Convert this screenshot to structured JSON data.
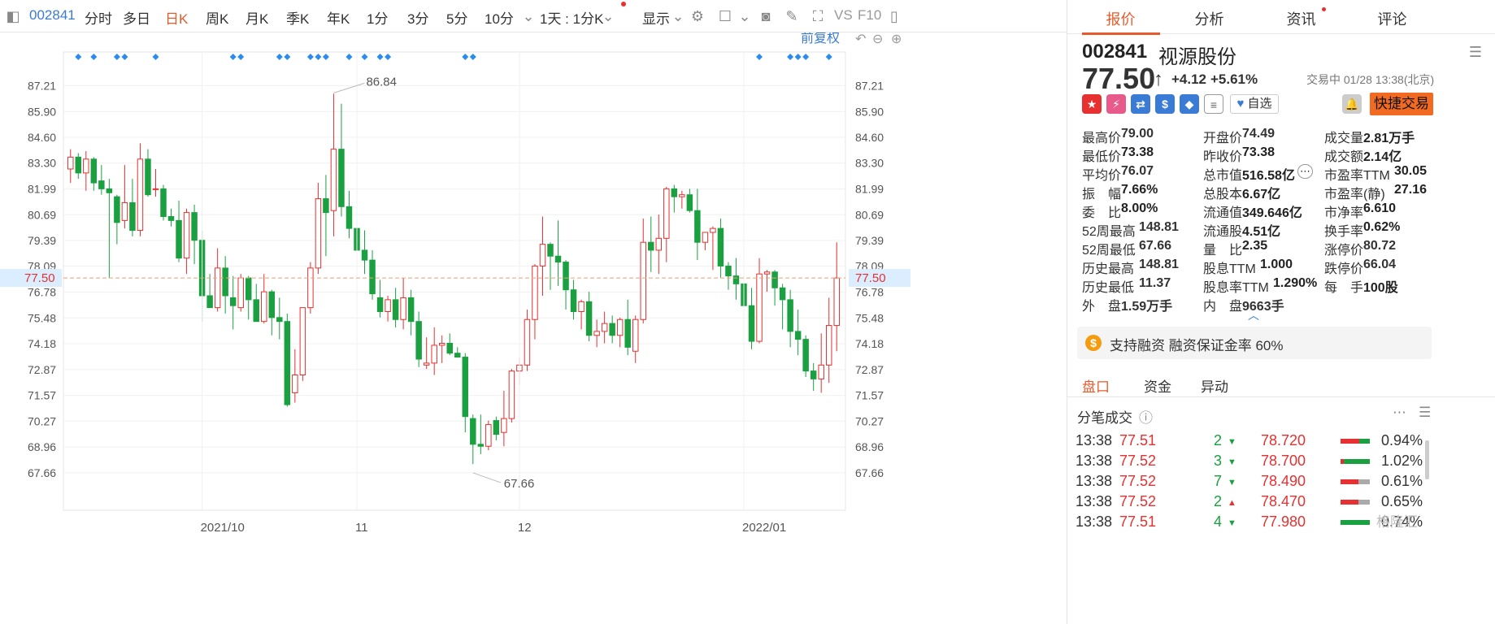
{
  "toolbar": {
    "code": "002841",
    "periods": [
      "分时",
      "多日",
      "日K",
      "周K",
      "月K",
      "季K",
      "年K",
      "1分",
      "3分",
      "5分",
      "10分"
    ],
    "active_period": "日K",
    "range_label": "1天 : 1分K",
    "display_label": "显示",
    "vs_label": "VS",
    "f10_label": "F10"
  },
  "chart": {
    "adjust_label": "前复权",
    "price_ticks": [
      "87.21",
      "85.90",
      "84.60",
      "83.30",
      "81.99",
      "80.69",
      "79.39",
      "78.09",
      "76.78",
      "75.48",
      "74.18",
      "72.87",
      "71.57",
      "70.27",
      "68.96",
      "67.66"
    ],
    "current_price_label": "77.50",
    "date_labels": [
      "2021/10",
      "11",
      "12",
      "2022/01"
    ],
    "max_label": "86.84",
    "min_label": "67.66",
    "accent_up": "#e73030",
    "accent_down": "#1aa040"
  },
  "chart_data": {
    "type": "candlestick",
    "ylim": [
      67.0,
      87.8
    ],
    "last_price": 77.5,
    "high_marker": 86.84,
    "low_marker": 67.66,
    "x_labels": [
      "2021/10",
      "11",
      "12",
      "2022/01"
    ],
    "candles": [
      [
        83.0,
        84.0,
        82.3,
        83.6
      ],
      [
        83.6,
        83.8,
        82.5,
        82.8
      ],
      [
        82.8,
        83.9,
        81.9,
        83.5
      ],
      [
        83.5,
        83.6,
        81.9,
        82.3
      ],
      [
        82.4,
        83.2,
        81.7,
        82.0
      ],
      [
        82.0,
        82.5,
        77.5,
        81.8
      ],
      [
        81.6,
        81.7,
        79.2,
        80.3
      ],
      [
        80.4,
        83.2,
        80.0,
        81.3
      ],
      [
        81.3,
        82.5,
        79.6,
        79.9
      ],
      [
        79.9,
        84.3,
        79.6,
        83.5
      ],
      [
        83.5,
        84.0,
        81.6,
        81.7
      ],
      [
        82.0,
        83.0,
        81.6,
        82.0
      ],
      [
        82.0,
        82.2,
        80.4,
        80.6
      ],
      [
        80.6,
        81.0,
        80.1,
        80.4
      ],
      [
        80.4,
        81.4,
        78.3,
        78.5
      ],
      [
        78.5,
        81.0,
        77.7,
        80.8
      ],
      [
        80.8,
        81.2,
        78.2,
        79.4
      ],
      [
        79.4,
        79.9,
        75.3,
        76.6
      ],
      [
        76.6,
        77.7,
        76.3,
        76.0
      ],
      [
        76.0,
        79.0,
        75.8,
        78.0
      ],
      [
        78.0,
        78.6,
        75.7,
        76.6
      ],
      [
        76.5,
        77.6,
        74.9,
        76.1
      ],
      [
        76.0,
        77.7,
        75.8,
        77.5
      ],
      [
        77.5,
        77.6,
        75.4,
        76.4
      ],
      [
        76.4,
        77.2,
        75.5,
        75.3
      ],
      [
        75.3,
        77.7,
        75.2,
        76.8
      ],
      [
        76.8,
        76.9,
        74.6,
        75.5
      ],
      [
        75.5,
        76.5,
        74.4,
        75.3
      ],
      [
        75.3,
        75.7,
        71.0,
        71.1
      ],
      [
        71.7,
        73.9,
        71.2,
        72.6
      ],
      [
        72.6,
        75.8,
        72.3,
        76.0
      ],
      [
        76.0,
        78.3,
        75.7,
        78.0
      ],
      [
        78.0,
        82.3,
        77.7,
        81.5
      ],
      [
        81.5,
        82.7,
        78.6,
        80.8
      ],
      [
        80.9,
        86.8,
        79.6,
        84.0
      ],
      [
        84.0,
        86.3,
        80.6,
        81.1
      ],
      [
        81.1,
        81.9,
        79.5,
        80.0
      ],
      [
        80.0,
        81.0,
        78.4,
        78.9
      ],
      [
        78.9,
        79.9,
        77.7,
        78.4
      ],
      [
        78.4,
        78.9,
        76.4,
        76.7
      ],
      [
        76.5,
        77.4,
        75.5,
        75.8
      ],
      [
        75.8,
        76.6,
        75.3,
        76.4
      ],
      [
        76.4,
        77.0,
        75.0,
        75.4
      ],
      [
        75.4,
        77.5,
        74.9,
        76.5
      ],
      [
        76.5,
        76.9,
        74.6,
        75.3
      ],
      [
        75.3,
        75.8,
        73.0,
        73.4
      ],
      [
        73.1,
        74.5,
        72.9,
        73.2
      ],
      [
        73.2,
        75.0,
        72.6,
        74.1
      ],
      [
        74.1,
        74.6,
        73.2,
        74.2
      ],
      [
        74.2,
        74.7,
        73.6,
        73.7
      ],
      [
        73.7,
        74.0,
        73.5,
        73.5
      ],
      [
        73.5,
        73.7,
        69.7,
        70.5
      ],
      [
        70.4,
        70.6,
        68.1,
        69.1
      ],
      [
        69.1,
        70.6,
        68.6,
        69.0
      ],
      [
        69.0,
        70.3,
        68.8,
        70.1
      ],
      [
        70.3,
        70.5,
        69.3,
        69.6
      ],
      [
        69.7,
        71.8,
        69.0,
        70.4
      ],
      [
        70.4,
        72.9,
        70.2,
        72.8
      ],
      [
        72.8,
        73.5,
        72.1,
        73.1
      ],
      [
        73.1,
        75.9,
        72.8,
        75.4
      ],
      [
        75.4,
        78.2,
        74.4,
        78.1
      ],
      [
        78.1,
        80.6,
        76.6,
        79.2
      ],
      [
        79.2,
        79.3,
        76.9,
        78.6
      ],
      [
        78.6,
        80.4,
        77.1,
        78.3
      ],
      [
        78.3,
        78.4,
        75.9,
        76.9
      ],
      [
        76.9,
        77.4,
        75.4,
        75.8
      ],
      [
        75.8,
        76.4,
        74.9,
        76.3
      ],
      [
        76.3,
        76.8,
        74.3,
        74.6
      ],
      [
        74.6,
        75.4,
        74.0,
        74.8
      ],
      [
        74.8,
        75.8,
        74.2,
        75.2
      ],
      [
        75.2,
        75.6,
        74.2,
        74.6
      ],
      [
        74.6,
        75.5,
        74.0,
        75.4
      ],
      [
        75.4,
        76.4,
        73.6,
        74.0
      ],
      [
        73.8,
        75.6,
        73.2,
        75.4
      ],
      [
        75.4,
        80.5,
        75.2,
        79.3
      ],
      [
        79.3,
        80.6,
        77.8,
        78.9
      ],
      [
        78.9,
        80.7,
        77.7,
        79.5
      ],
      [
        79.5,
        82.1,
        78.3,
        82.0
      ],
      [
        82.0,
        82.2,
        80.8,
        81.6
      ],
      [
        81.6,
        81.9,
        81.0,
        81.7
      ],
      [
        81.7,
        82.0,
        80.8,
        80.9
      ],
      [
        80.9,
        82.0,
        78.4,
        79.3
      ],
      [
        79.3,
        79.8,
        78.9,
        79.8
      ],
      [
        79.8,
        80.1,
        77.9,
        80.0
      ],
      [
        80.0,
        80.5,
        77.5,
        78.1
      ],
      [
        78.1,
        78.3,
        76.9,
        77.6
      ],
      [
        77.6,
        78.5,
        76.4,
        77.2
      ],
      [
        77.2,
        78.0,
        74.7,
        76.1
      ],
      [
        76.1,
        77.0,
        73.9,
        74.3
      ],
      [
        74.3,
        78.5,
        74.2,
        77.7
      ],
      [
        77.7,
        77.9,
        76.8,
        77.8
      ],
      [
        77.8,
        77.9,
        76.1,
        77.0
      ],
      [
        77.0,
        77.2,
        74.9,
        76.4
      ],
      [
        76.4,
        76.9,
        74.0,
        74.8
      ],
      [
        74.8,
        75.9,
        73.6,
        74.4
      ],
      [
        74.4,
        74.6,
        72.5,
        72.8
      ],
      [
        72.8,
        73.2,
        71.8,
        72.4
      ],
      [
        72.4,
        74.7,
        71.7,
        73.1
      ],
      [
        73.1,
        76.5,
        72.2,
        75.1
      ],
      [
        75.1,
        79.3,
        73.8,
        77.5
      ]
    ],
    "event_markers_count": 23
  },
  "quote": {
    "tabs": [
      "报价",
      "分析",
      "资讯",
      "评论"
    ],
    "active_tab": "报价",
    "code": "002841",
    "name": "视源股份",
    "price": "77.50",
    "change": "+4.12",
    "change_pct": "+5.61%",
    "status_time": "交易中 01/28 13:38(北京)",
    "watch_label": "自选",
    "trade_label": "快捷交易",
    "stats": [
      {
        "label": "最高价",
        "value": "79.00",
        "color": "red"
      },
      {
        "label": "开盘价",
        "value": "74.49",
        "color": "red"
      },
      {
        "label": "成交量",
        "value": "2.81万手",
        "color": "dark"
      },
      {
        "label": "最低价",
        "value": "73.38",
        "color": "dark"
      },
      {
        "label": "昨收价",
        "value": "73.38",
        "color": "dark"
      },
      {
        "label": "成交额",
        "value": "2.14亿",
        "color": "dark"
      },
      {
        "label": "平均价",
        "value": "76.07",
        "color": "red"
      },
      {
        "label": "总市值",
        "value": "516.58亿",
        "color": "dark"
      },
      {
        "label": "市盈率TTM",
        "value": "30.05",
        "color": "dark"
      },
      {
        "label": "振　幅",
        "value": "7.66%",
        "color": "dark"
      },
      {
        "label": "总股本",
        "value": "6.67亿",
        "color": "dark"
      },
      {
        "label": "市盈率(静)",
        "value": "27.16",
        "color": "dark"
      },
      {
        "label": "委　比",
        "value": "8.00%",
        "color": "dark"
      },
      {
        "label": "流通值",
        "value": "349.646亿",
        "color": "dark"
      },
      {
        "label": "市净率",
        "value": "6.610",
        "color": "dark"
      },
      {
        "label": "52周最高",
        "value": "148.81",
        "color": "red"
      },
      {
        "label": "流通股",
        "value": "4.51亿",
        "color": "dark"
      },
      {
        "label": "换手率",
        "value": "0.62%",
        "color": "dark"
      },
      {
        "label": "52周最低",
        "value": "67.66",
        "color": "green"
      },
      {
        "label": "量　比",
        "value": "2.35",
        "color": "dark"
      },
      {
        "label": "涨停价",
        "value": "80.72",
        "color": "red"
      },
      {
        "label": "历史最高",
        "value": "148.81",
        "color": "red"
      },
      {
        "label": "股息TTM",
        "value": "1.000",
        "color": "dark"
      },
      {
        "label": "跌停价",
        "value": "66.04",
        "color": "green"
      },
      {
        "label": "历史最低",
        "value": "11.37",
        "color": "green"
      },
      {
        "label": "股息率TTM",
        "value": "1.290%",
        "color": "dark"
      },
      {
        "label": "每　手",
        "value": "100股",
        "color": "dark"
      },
      {
        "label": "外　盘",
        "value": "1.59万手",
        "color": "red"
      },
      {
        "label": "内　盘",
        "value": "9663手",
        "color": "green"
      }
    ],
    "margin_notice": "支持融资 融资保证金率 60%",
    "sub_tabs": [
      "盘口",
      "资金",
      "异动"
    ],
    "active_sub_tab": "盘口",
    "ticks_title": "分笔成交",
    "ticks": [
      {
        "time": "13:38",
        "price": "77.51",
        "count": "2",
        "dir": "down",
        "p2": "78.720",
        "pct": "0.94%",
        "ratio": 0.35
      },
      {
        "time": "13:38",
        "price": "77.52",
        "count": "3",
        "dir": "down",
        "p2": "78.700",
        "pct": "1.02%",
        "ratio": 0.9
      },
      {
        "time": "13:38",
        "price": "77.52",
        "count": "7",
        "dir": "down",
        "p2": "78.490",
        "pct": "0.61%",
        "ratio": 0.0
      },
      {
        "time": "13:38",
        "price": "77.52",
        "count": "2",
        "dir": "up",
        "p2": "78.470",
        "pct": "0.65%",
        "ratio": 0.0
      },
      {
        "time": "13:38",
        "price": "77.51",
        "count": "4",
        "dir": "down",
        "p2": "77.980",
        "pct": "0.74%",
        "ratio": 1.0
      }
    ],
    "watermark": "格隆汇"
  }
}
